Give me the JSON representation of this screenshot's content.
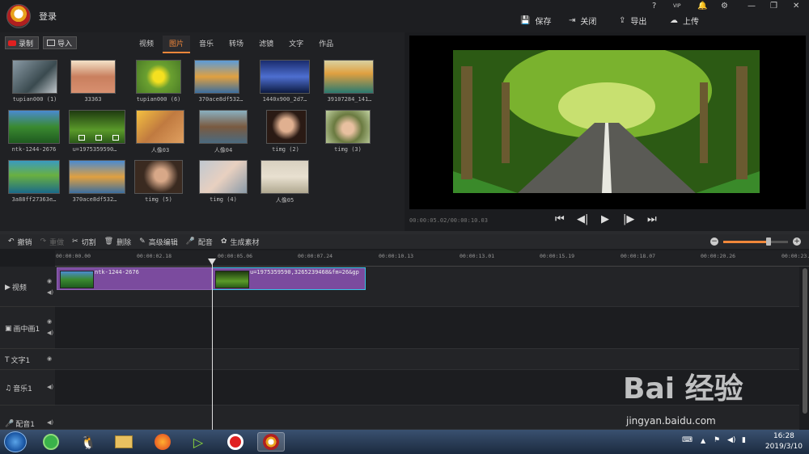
{
  "app": {
    "login": "登录",
    "win_help": "?",
    "win_vip": "VIP"
  },
  "topbar": {
    "save": "保存",
    "close": "关闭",
    "export": "导出",
    "upload": "上传"
  },
  "media": {
    "record": "录制",
    "import": "导入",
    "tabs": [
      "视频",
      "图片",
      "音乐",
      "转场",
      "滤镜",
      "文字",
      "作品"
    ],
    "active_tab": "图片",
    "items": [
      {
        "label": "tupian000 (1)"
      },
      {
        "label": "33363"
      },
      {
        "label": "tupian000 (6)"
      },
      {
        "label": "370ace8df532…"
      },
      {
        "label": "1440x900_2d7…"
      },
      {
        "label": "39107284_141…"
      },
      {
        "label": "ntk-1244-2676"
      },
      {
        "label": "u=1975359590…"
      },
      {
        "label": "人像03"
      },
      {
        "label": "人像04"
      },
      {
        "label": "timg (2)"
      },
      {
        "label": "timg (3)"
      },
      {
        "label": "3a88ff27363e…"
      },
      {
        "label": "370ace8df532…"
      },
      {
        "label": "timg (5)"
      },
      {
        "label": "timg (4)"
      },
      {
        "label": "人像05"
      }
    ]
  },
  "preview": {
    "time": "00:00:05.02/00:00:10.03"
  },
  "toolbar": {
    "undo": "撤销",
    "redo": "重做",
    "cut": "切割",
    "delete": "删除",
    "advanced": "高级编辑",
    "dub": "配音",
    "generate": "生成素材"
  },
  "timeline": {
    "ticks": [
      "00:00:00.00",
      "00:00:02.18",
      "00:00:05.06",
      "00:00:07.24",
      "00:00:10.13",
      "00:00:13.01",
      "00:00:15.19",
      "00:00:18.07",
      "00:00:20.26",
      "00:00:23."
    ],
    "tracks": [
      "视频",
      "画中画1",
      "文字1",
      "音乐1",
      "配音1"
    ],
    "clips": [
      {
        "label": "ntk-1244-2676"
      },
      {
        "label": "u=1975359590,3265239468&fm=26&gp"
      }
    ]
  },
  "taskbar": {
    "time": "16:28",
    "date": "2019/3/10"
  },
  "watermark": {
    "brand": "Bai 经验",
    "url": "jingyan.baidu.com"
  },
  "colors": {
    "accent": "#f0873a",
    "clip": "#7b4b9e",
    "selected": "#39c4e8"
  }
}
